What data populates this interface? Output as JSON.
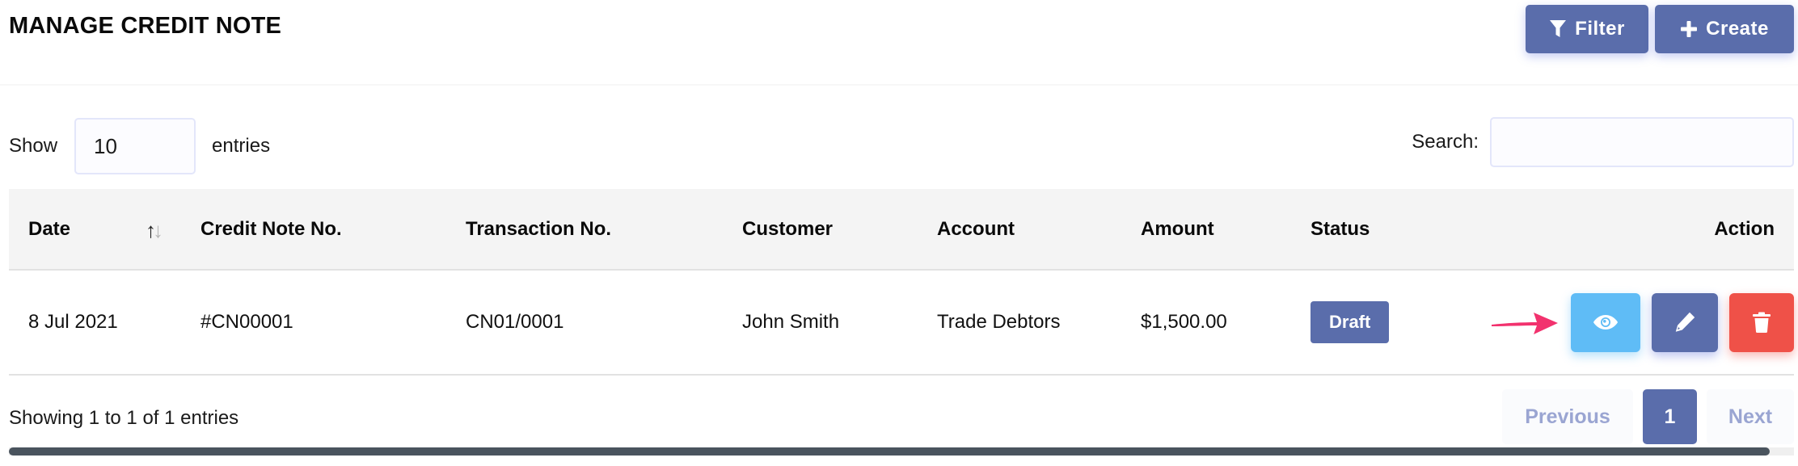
{
  "header": {
    "title": "MANAGE CREDIT NOTE",
    "filter_label": "Filter",
    "create_label": "Create"
  },
  "controls": {
    "show_label": "Show",
    "page_length_value": "10",
    "entries_label": "entries",
    "search_label": "Search:",
    "search_value": "",
    "search_placeholder": ""
  },
  "table": {
    "columns": [
      "Date",
      "Credit Note No.",
      "Transaction No.",
      "Customer",
      "Account",
      "Amount",
      "Status",
      "Action"
    ],
    "sort_icon": "sort-up-down",
    "rows": [
      {
        "date": "8 Jul 2021",
        "credit_note_no": "#CN00001",
        "transaction_no": "CN01/0001",
        "customer": "John Smith",
        "account": "Trade Debtors",
        "amount": "$1,500.00",
        "status": "Draft",
        "actions": [
          "view",
          "edit",
          "delete"
        ]
      }
    ]
  },
  "footer": {
    "info": "Showing 1 to 1 of 1 entries",
    "pagination": {
      "previous_label": "Previous",
      "current_page": "1",
      "next_label": "Next"
    }
  },
  "colors": {
    "primary": "#5a6dab",
    "info": "#5fbcf6",
    "danger": "#ef5148",
    "annotation_arrow": "#f2326e"
  }
}
